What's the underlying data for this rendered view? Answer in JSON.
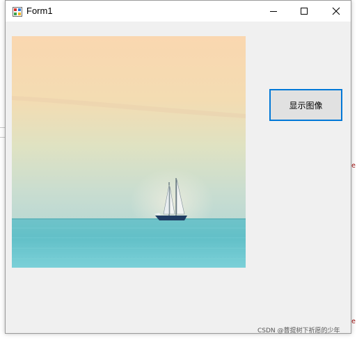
{
  "window": {
    "title": "Form1",
    "caption_buttons": [
      "minimize",
      "maximize",
      "close"
    ]
  },
  "client": {
    "button_label": "显示图像",
    "picture": "sailboat-on-sea"
  },
  "watermark": "CSDN @菩提树下祈愿的少年",
  "colors": {
    "window_bg": "#f0f0f0",
    "titlebar_bg": "#ffffff",
    "button_border": "#0078d7",
    "button_bg": "#e1e1e1"
  }
}
